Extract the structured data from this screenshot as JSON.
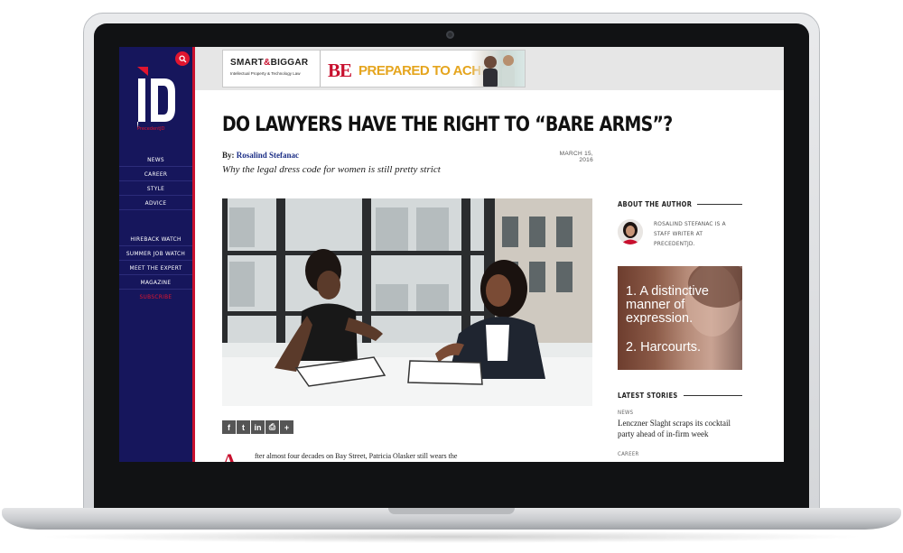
{
  "colors": {
    "sidebar_bg": "#16165c",
    "accent_red": "#c8102e",
    "ad_gold": "#e5a51e",
    "author_link": "#1b2e86"
  },
  "sidebar": {
    "logo_text": "jD",
    "logo_subtext": "PrecedentJD",
    "search_icon": "search-icon",
    "primary_nav": [
      "NEWS",
      "CAREER",
      "STYLE",
      "ADVICE"
    ],
    "secondary_nav": [
      "HIREBACK WATCH",
      "SUMMER JOB WATCH",
      "MEET THE EXPERT",
      "MAGAZINE",
      "SUBSCRIBE"
    ]
  },
  "banner_ad": {
    "brand_left": "SMART",
    "brand_amp": "&",
    "brand_right": "BIGGAR",
    "tagline": "Intellectual Property & Technology Law",
    "be": "BE",
    "slogan": "PREPARED TO ACHIEVE"
  },
  "article": {
    "title": "DO LAWYERS HAVE THE RIGHT TO “BARE ARMS”?",
    "by_label": "By:",
    "author": "Rosalind Stefanac",
    "date": "MARCH 15, 2016",
    "dek": "Why the legal dress code for women is still pretty strict",
    "dropcap": "A",
    "body_first_line": "fter almost four decades on Bay Street, Patricia Olasker still wears the",
    "share_icons": [
      "facebook-icon",
      "twitter-icon",
      "linkedin-icon",
      "print-icon",
      "plus-icon"
    ],
    "share_glyphs": [
      "f",
      "t",
      "in",
      "⎙",
      "+"
    ]
  },
  "about_author": {
    "heading": "ABOUT THE AUTHOR",
    "bio": "ROSALIND STEFANAC IS A STAFF WRITER AT PRECEDENTJD."
  },
  "side_ad": {
    "line1": "1. A distinctive manner of expression.",
    "line2": "2. Harcourts."
  },
  "latest_stories": {
    "heading": "LATEST STORIES",
    "items": [
      {
        "category": "NEWS",
        "title": "Lenczner Slaght scraps its cocktail party ahead of in-firm week"
      },
      {
        "category": "CAREER",
        "title": ""
      }
    ]
  }
}
